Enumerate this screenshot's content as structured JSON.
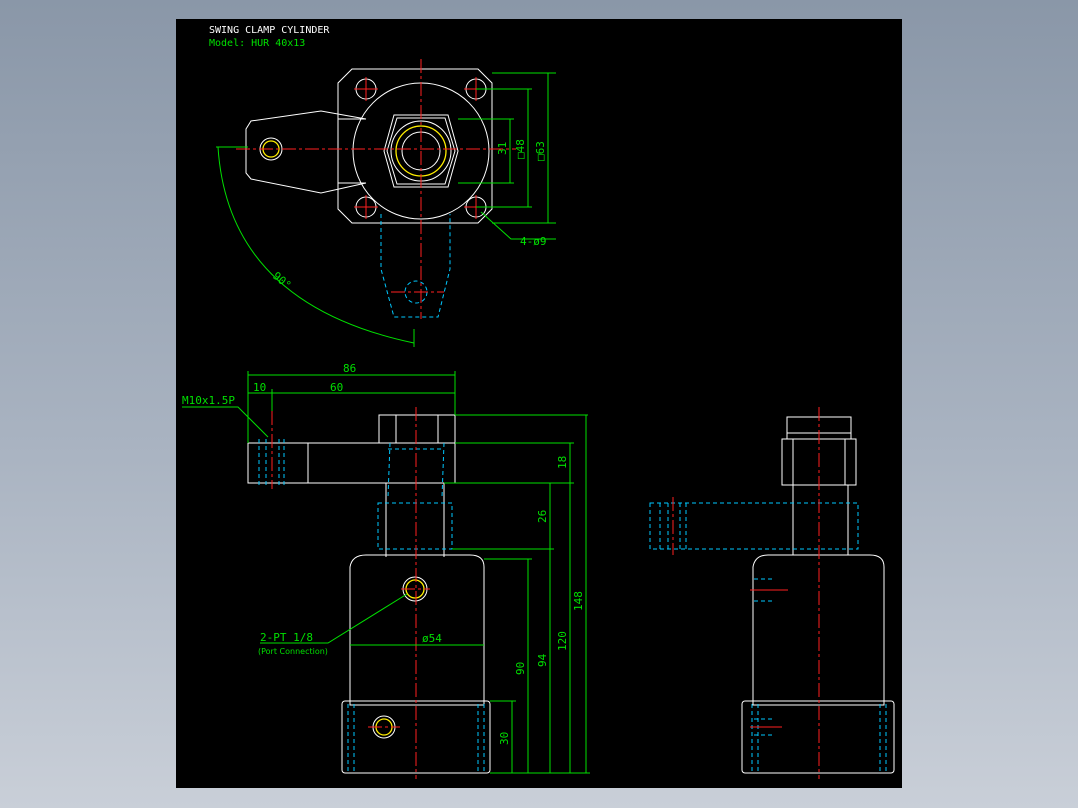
{
  "title": "SWING CLAMP CYLINDER",
  "model": "Model: HUR 40x13",
  "dimensions": {
    "d31": "31",
    "d48": "□48",
    "d63": "□63",
    "holes": "4-ø9",
    "angle": "90°",
    "d86": "86",
    "d10": "10",
    "d60": "60",
    "thread": "M10x1.5P",
    "d18": "18",
    "d26": "26",
    "d148": "148",
    "d120": "120",
    "d94": "94",
    "d90": "90",
    "d30": "30",
    "d54": "ø54",
    "port": "2-PT 1/8",
    "port_note": "(Port Connection)"
  },
  "colors": {
    "background": "#000000",
    "outline": "#ffffff",
    "center_line": "#ff2020",
    "hidden_line": "#00c8ff",
    "dimension": "#00e000",
    "highlight": "#ffee00"
  }
}
